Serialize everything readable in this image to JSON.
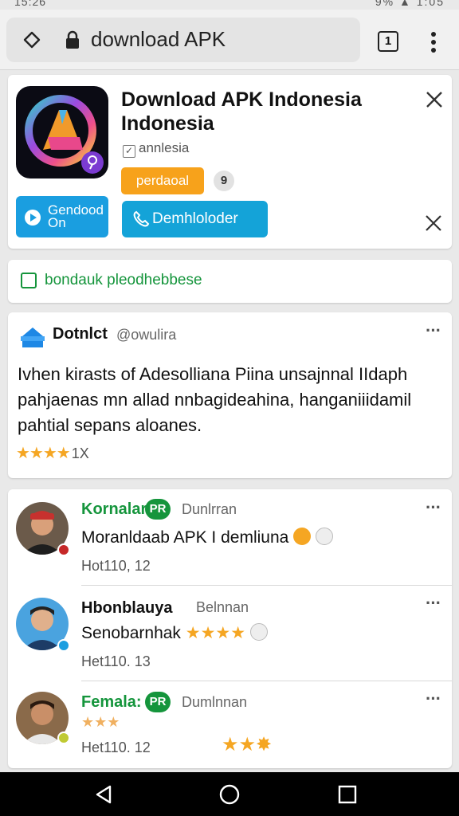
{
  "status_bar": {
    "left": "15:26",
    "right": "9% ▲ 1:05"
  },
  "browser": {
    "url": "download APK",
    "tab_count": "1"
  },
  "app_card": {
    "title": "Download APK Indonesia Indonesia",
    "developer": "annlesia",
    "badge_label": "perdaoal",
    "badge_count": "9",
    "button_small_label": "Gendood On",
    "button_main_label": "Demhloloder",
    "colors": {
      "orange": "#f7a21b",
      "blue": "#1a9ee0"
    }
  },
  "link_card": {
    "text": "bondauk pleodhebbese"
  },
  "post": {
    "author": "Dotnlct",
    "handle": "@owulira",
    "body": "Ivhen kirasts of Adesolliana Piina unsajnnal IIdaph pahjaenas mn allad nnbagideahina, hanganiiidamil pahtial sepans aloanes.",
    "stars": "★★★★",
    "rating_value": "1X",
    "more": "···"
  },
  "comments": [
    {
      "name": "Kornalar",
      "badge": "PR",
      "sub": "Dunlrran",
      "text": "Moranldaab APK I demliuna",
      "time": "Hot110, 12",
      "more": "···"
    },
    {
      "name": "Hbonblauya",
      "badge": "",
      "sub": "Belnnan",
      "text": "Senobarnhak",
      "text_stars": "★★★★",
      "time": "Het110. 13",
      "more": "···"
    },
    {
      "name": "Femala:",
      "badge": "PR",
      "sub": "Dumlnnan",
      "text_stars": "★★★",
      "time": "Het110. 12",
      "time_stars": "★★✸",
      "more": "···"
    }
  ]
}
